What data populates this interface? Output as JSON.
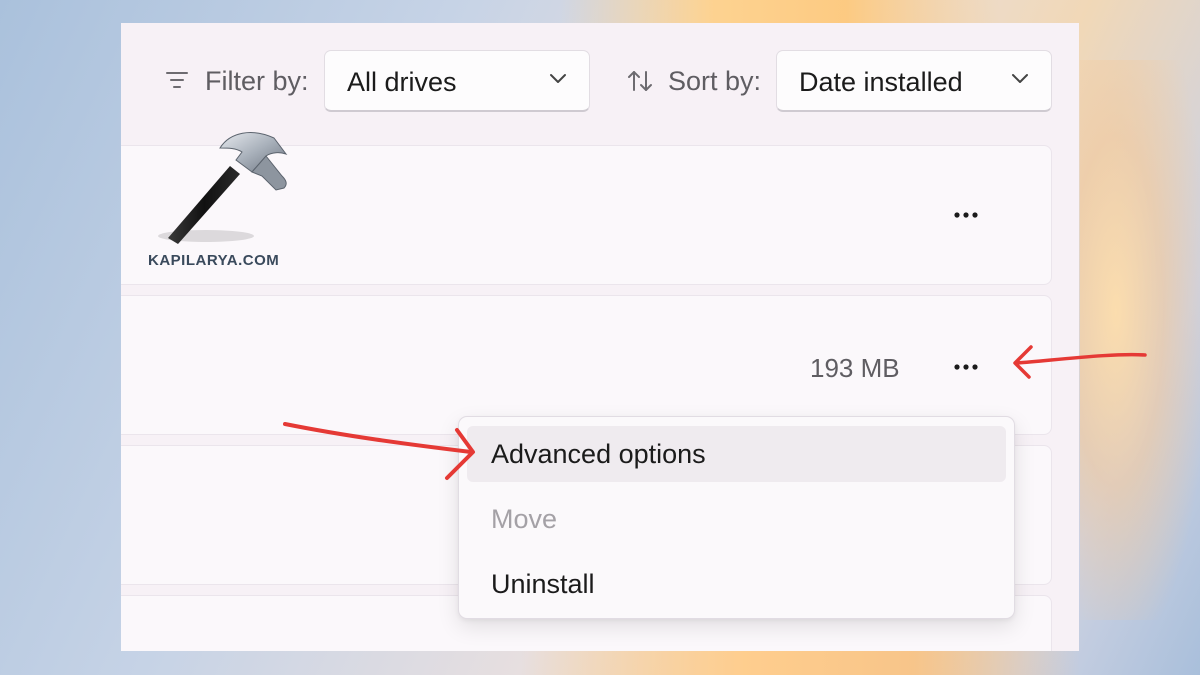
{
  "toolbar": {
    "filter_label": "Filter by:",
    "filter_value": "All drives",
    "sort_label": "Sort by:",
    "sort_value": "Date installed"
  },
  "apps": [
    {
      "size": "",
      "more_icon": "more-horizontal-icon"
    },
    {
      "size": "193 MB",
      "more_icon": "more-horizontal-icon"
    },
    {
      "size": ""
    },
    {
      "size": ""
    }
  ],
  "context_menu": {
    "items": [
      {
        "label": "Advanced options",
        "state": "hover"
      },
      {
        "label": "Move",
        "state": "disabled"
      },
      {
        "label": "Uninstall",
        "state": "normal"
      }
    ]
  },
  "watermark": {
    "text": "KAPILARYA.COM"
  },
  "annotation_color": "#e53935"
}
